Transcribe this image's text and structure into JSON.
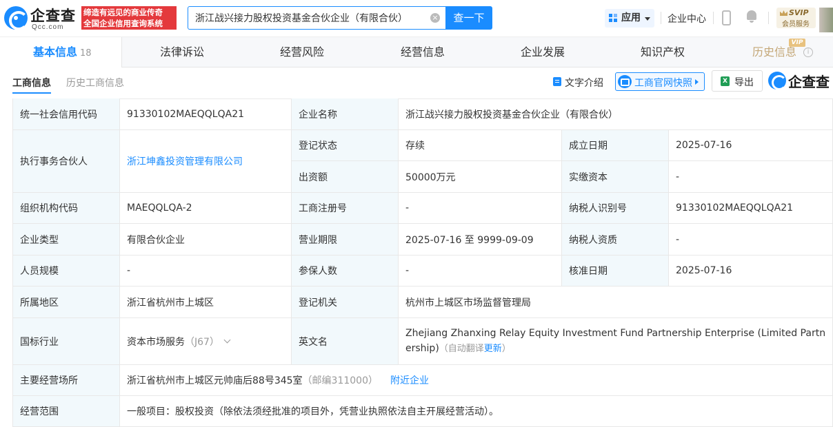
{
  "header": {
    "logo_text": "企查查",
    "logo_sub": "Qcc.com",
    "slogan_line1": "缔造有远见的商业传奇",
    "slogan_line2": "全国企业信用查询系统",
    "search_value": "浙江战兴接力股权投资基金合伙企业（有限合伙）",
    "search_button": "查一下",
    "app_label": "应用",
    "enterprise_center": "企业中心",
    "svip_title": "SVIP",
    "svip_sub": "会员服务"
  },
  "tabs": [
    {
      "label": "基本信息",
      "count": "18"
    },
    {
      "label": "法律诉讼"
    },
    {
      "label": "经营风险"
    },
    {
      "label": "经营信息"
    },
    {
      "label": "企业发展"
    },
    {
      "label": "知识产权"
    },
    {
      "label": "历史信息",
      "badge": "VIP"
    }
  ],
  "subtabs": {
    "active": "工商信息",
    "inactive": "历史工商信息"
  },
  "toolbar": {
    "text_intro": "文字介绍",
    "official_snapshot": "工商官网快照",
    "export": "导出",
    "brand": "企查查"
  },
  "table": {
    "credit_code_label": "统一社会信用代码",
    "credit_code": "91330102MAEQQLQA21",
    "company_name_label": "企业名称",
    "company_name": "浙江战兴接力股权投资基金合伙企业（有限合伙）",
    "partner_label": "执行事务合伙人",
    "partner": "浙江坤鑫投资管理有限公司",
    "reg_status_label": "登记状态",
    "reg_status": "存续",
    "found_date_label": "成立日期",
    "found_date": "2025-07-16",
    "capital_label": "出资额",
    "capital": "50000万元",
    "paid_capital_label": "实缴资本",
    "paid_capital": "-",
    "org_code_label": "组织机构代码",
    "org_code": "MAEQQLQA-2",
    "reg_no_label": "工商注册号",
    "reg_no": "-",
    "taxpayer_id_label": "纳税人识别号",
    "taxpayer_id": "91330102MAEQQLQA21",
    "type_label": "企业类型",
    "type": "有限合伙企业",
    "term_label": "营业期限",
    "term": "2025-07-16 至 9999-09-09",
    "tax_qual_label": "纳税人资质",
    "tax_qual": "-",
    "staff_label": "人员规模",
    "staff": "-",
    "insured_label": "参保人数",
    "insured": "-",
    "approve_date_label": "核准日期",
    "approve_date": "2025-07-16",
    "region_label": "所属地区",
    "region": "浙江省杭州市上城区",
    "authority_label": "登记机关",
    "authority": "杭州市上城区市场监督管理局",
    "industry_label": "国标行业",
    "industry": "资本市场服务",
    "industry_code": "（J67）",
    "english_label": "英文名",
    "english_name": "Zhejiang Zhanxing Relay Equity Investment Fund Partnership Enterprise (Limited Partnership)",
    "auto_translate": "（自动翻译",
    "update": "更新",
    "close_paren": "）",
    "address_label": "主要经营场所",
    "address": "浙江省杭州市上城区元帅庙后88号345室",
    "postcode": "（邮编311000）",
    "nearby": "附近企业",
    "scope_label": "经营范围",
    "scope": "一般项目：股权投资（除依法须经批准的项目外，凭营业执照依法自主开展经营活动）。"
  },
  "colors": {
    "accent": "#1a8cff",
    "label_bg": "#f2f9fc",
    "slogan_red": "#e4393c"
  }
}
